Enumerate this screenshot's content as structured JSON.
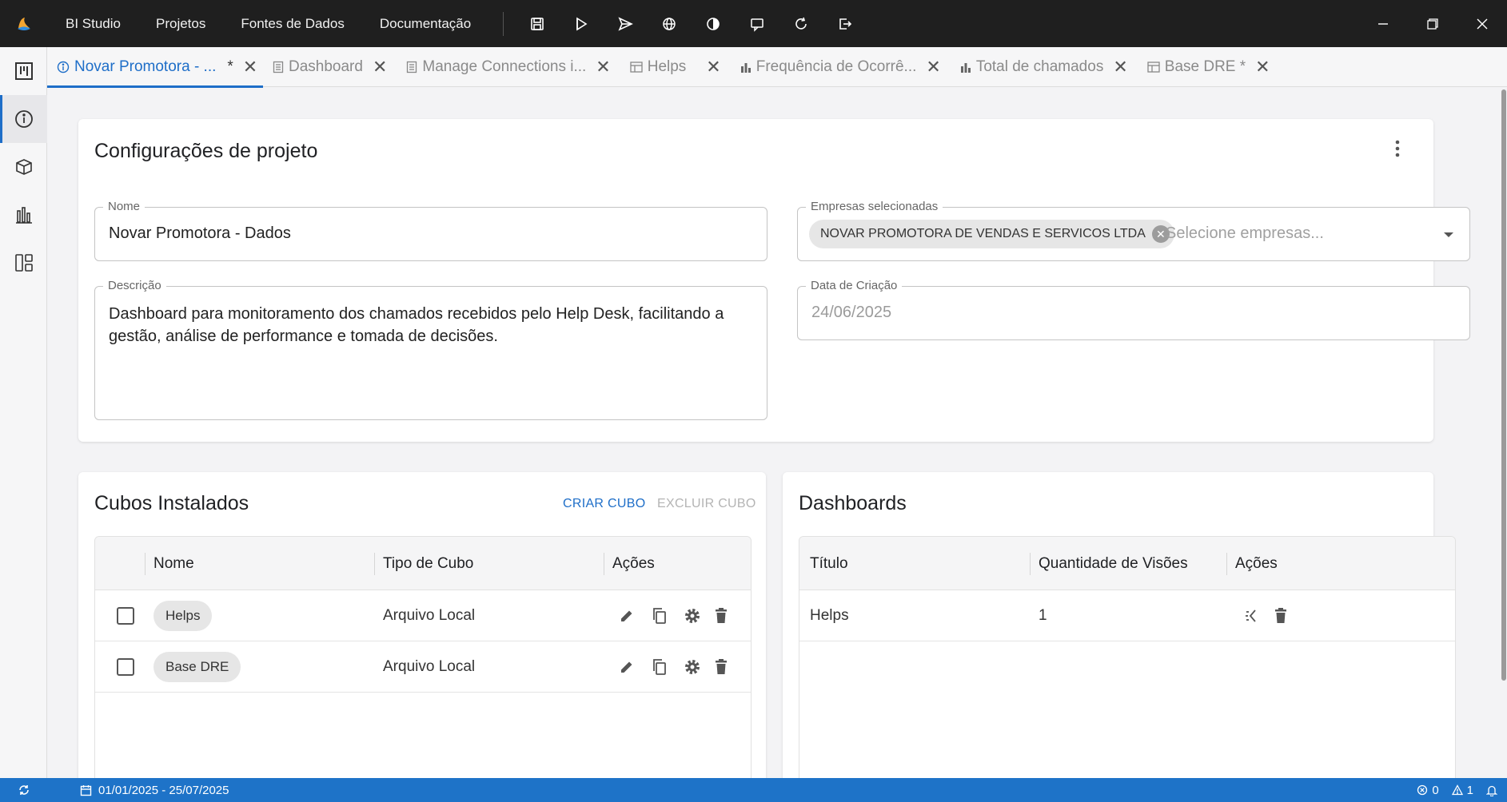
{
  "menu": {
    "items": [
      {
        "label": "BI Studio"
      },
      {
        "label": "Projetos"
      },
      {
        "label": "Fontes de Dados"
      },
      {
        "label": "Documentação"
      }
    ]
  },
  "toolbar_icons": [
    "save-icon",
    "run-icon",
    "send-icon",
    "globe-icon",
    "contrast-icon",
    "comment-icon",
    "refresh-icon",
    "exit-icon"
  ],
  "window_controls": [
    "minimize-icon",
    "restore-icon",
    "close-icon"
  ],
  "rail": [
    "kanban-icon",
    "info-icon",
    "cube-icon",
    "bar-chart-icon",
    "dashboard-layout-icon"
  ],
  "tabs": [
    {
      "label": "Novar Promotora - ...",
      "dirty": "*",
      "icon": "info-icon",
      "active": true
    },
    {
      "label": "Dashboard",
      "icon": "document-icon"
    },
    {
      "label": "Manage Connections i...",
      "icon": "document-icon"
    },
    {
      "label": "Helps",
      "icon": "table-icon"
    },
    {
      "label": "Frequência de Ocorrê...",
      "icon": "bar-chart-icon"
    },
    {
      "label": "Total de chamados",
      "icon": "bar-chart-icon"
    },
    {
      "label": "Base DRE *",
      "icon": "table-icon"
    }
  ],
  "project": {
    "title": "Configurações de projeto",
    "name_label": "Nome",
    "name_value": "Novar Promotora - Dados",
    "companies_label": "Empresas selecionadas",
    "company_chip": "NOVAR PROMOTORA DE VENDAS E SERVICOS LTDA",
    "companies_placeholder": "Selecione empresas...",
    "description_label": "Descrição",
    "description_value": "Dashboard para monitoramento dos chamados recebidos pelo Help Desk, facilitando a gestão, análise de performance e tomada de decisões.",
    "created_label": "Data de Criação",
    "created_value": "24/06/2025"
  },
  "cubes": {
    "title": "Cubos Instalados",
    "create_label": "CRIAR CUBO",
    "delete_label": "EXCLUIR CUBO",
    "columns": [
      "Nome",
      "Tipo de Cubo",
      "Ações"
    ],
    "rows": [
      {
        "name": "Helps",
        "type": "Arquivo Local"
      },
      {
        "name": "Base DRE",
        "type": "Arquivo Local"
      }
    ]
  },
  "dashboards": {
    "title": "Dashboards",
    "columns": [
      "Título",
      "Quantidade de Visões",
      "Ações"
    ],
    "rows": [
      {
        "title": "Helps",
        "views": "1"
      }
    ]
  },
  "status": {
    "date_range": "01/01/2025 - 25/07/2025",
    "errors": "0",
    "warnings": "1"
  },
  "colors": {
    "accent": "#1e6ec8",
    "topbar": "#1f1f1f",
    "statusbar": "#1e73c8"
  }
}
